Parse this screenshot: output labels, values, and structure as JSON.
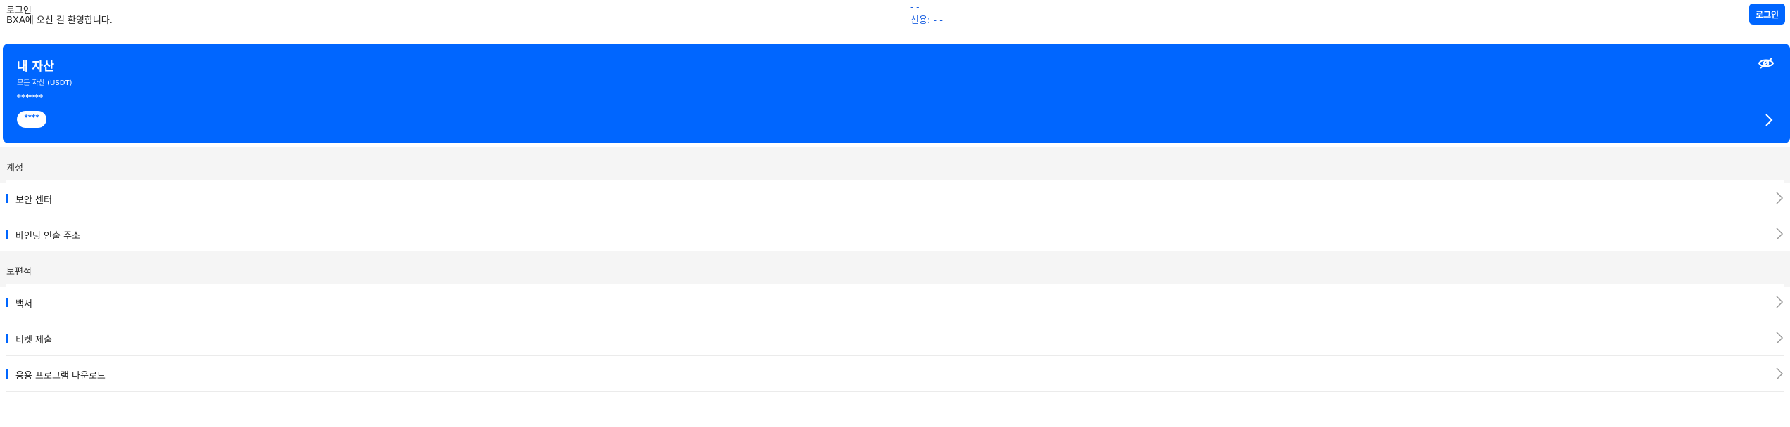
{
  "header": {
    "login_title": "로그인",
    "welcome": "BXA에 오신 걸 환영합니다.",
    "uid_placeholder": "- -",
    "credit": "신용: - -",
    "login_button": "로그인"
  },
  "asset_card": {
    "title": "내 자산",
    "subtitle": "모든 자산 (USDT)",
    "masked_value": "******",
    "pill_value": "****",
    "eye_icon": "eye-hidden-icon",
    "chevron_icon": "chevron-right-icon"
  },
  "sections": [
    {
      "label": "계정",
      "items": [
        {
          "label": "보안 센터"
        },
        {
          "label": "바인딩 인출 주소"
        }
      ]
    },
    {
      "label": "보편적",
      "items": [
        {
          "label": "백서"
        },
        {
          "label": "티켓 제출"
        },
        {
          "label": "응용 프로그램 다운로드"
        }
      ]
    }
  ],
  "colors": {
    "accent": "#0066ff",
    "section_bg": "#f5f5f5"
  }
}
